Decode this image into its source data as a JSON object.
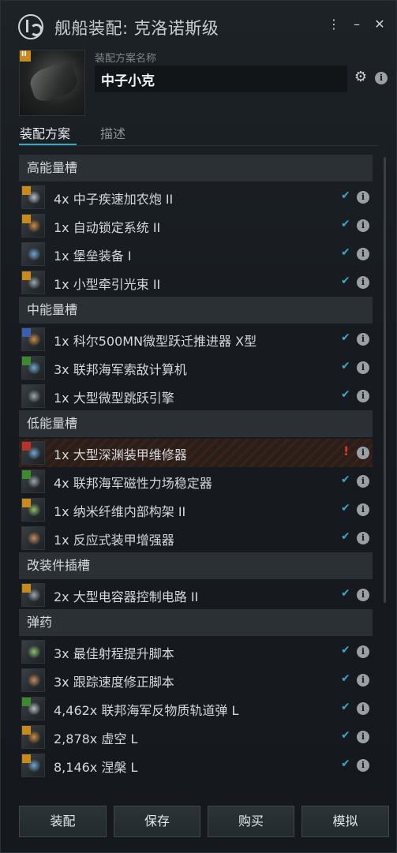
{
  "window": {
    "title": "舰船装配: 克洛诺斯级",
    "menu_glyph": "⋮",
    "minimize_glyph": "–",
    "close_glyph": "✕"
  },
  "fit": {
    "name_label": "装配方案名称",
    "name_value": "中子小克"
  },
  "tabs": [
    {
      "label": "装配方案",
      "active": true
    },
    {
      "label": "描述",
      "active": false
    }
  ],
  "sections": [
    {
      "title": "高能量槽",
      "items": [
        {
          "label": "4x 中子疾速加农炮 II",
          "status": "ok",
          "badge": "t2",
          "icon": "cannon-icon"
        },
        {
          "label": "1x 自动锁定系统 II",
          "status": "ok",
          "badge": "t2",
          "icon": "targeting-icon"
        },
        {
          "label": "1x 堡垒装备 I",
          "status": "ok",
          "badge": "none",
          "icon": "bastion-icon"
        },
        {
          "label": "1x 小型牵引光束 II",
          "status": "ok",
          "badge": "t2",
          "icon": "tractor-beam-icon"
        }
      ]
    },
    {
      "title": "中能量槽",
      "items": [
        {
          "label": "1x 科尔500MN微型跃迁推进器 X型",
          "status": "ok",
          "badge": "faction-blue",
          "icon": "microwarp-icon"
        },
        {
          "label": "3x 联邦海军索敌计算机",
          "status": "ok",
          "badge": "faction-green",
          "icon": "tracking-computer-icon"
        },
        {
          "label": "1x 大型微型跳跃引擎",
          "status": "ok",
          "badge": "none",
          "icon": "jump-drive-icon"
        }
      ]
    },
    {
      "title": "低能量槽",
      "items": [
        {
          "label": "1x 大型深渊装甲维修器",
          "status": "warning",
          "badge": "abyssal",
          "icon": "armor-repairer-icon"
        },
        {
          "label": "4x 联邦海军磁性力场稳定器",
          "status": "ok",
          "badge": "faction-green",
          "icon": "magnetic-stabilizer-icon"
        },
        {
          "label": "1x 纳米纤维内部构架 II",
          "status": "ok",
          "badge": "t2",
          "icon": "nanofiber-icon"
        },
        {
          "label": "1x 反应式装甲增强器",
          "status": "ok",
          "badge": "none",
          "icon": "reactive-armor-icon"
        }
      ]
    },
    {
      "title": "改装件插槽",
      "items": [
        {
          "label": "2x 大型电容器控制电路 II",
          "status": "ok",
          "badge": "t2",
          "icon": "capacitor-rig-icon"
        }
      ]
    },
    {
      "title": "弹药",
      "items": [
        {
          "label": "3x 最佳射程提升脚本",
          "status": "ok",
          "badge": "none",
          "icon": "optimal-script-icon"
        },
        {
          "label": "3x 跟踪速度修正脚本",
          "status": "ok",
          "badge": "none",
          "icon": "tracking-script-icon"
        },
        {
          "label": "4,462x 联邦海军反物质轨道弹 L",
          "status": "ok",
          "badge": "faction-green",
          "icon": "antimatter-charge-icon"
        },
        {
          "label": "2,878x 虚空 L",
          "status": "ok",
          "badge": "t2",
          "icon": "void-charge-icon"
        },
        {
          "label": "8,146x 涅槃 L",
          "status": "ok",
          "badge": "t2",
          "icon": "null-charge-icon"
        }
      ]
    }
  ],
  "status_glyphs": {
    "ok": "✔",
    "warning": "!"
  },
  "info_glyph": "i",
  "buttons": [
    "装配",
    "保存",
    "购买",
    "模拟"
  ],
  "colors": {
    "accent": "#3aa7c9",
    "warning": "#e0332a",
    "t2_badge": "#c98a1b",
    "faction_green": "#3c8a2d",
    "faction_blue": "#3a5fb0",
    "abyssal": "#b8322a"
  }
}
